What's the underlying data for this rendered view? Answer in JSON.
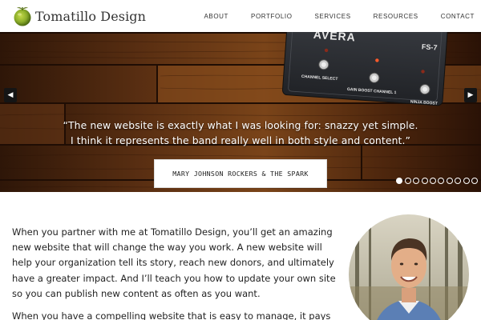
{
  "header": {
    "logo_text": "Tomatillo Design",
    "logo_icon": "tomatillo-icon",
    "nav": [
      {
        "label": "ABOUT"
      },
      {
        "label": "PORTFOLIO"
      },
      {
        "label": "SERVICES"
      },
      {
        "label": "RESOURCES"
      },
      {
        "label": "CONTACT"
      }
    ]
  },
  "hero": {
    "pedal_brand": "AVERA",
    "pedal_model": "FS-7",
    "knob_labels": [
      "CHANNEL SELECT",
      "GAIN BOOST CHANNEL 1",
      "NINJA BOOST"
    ],
    "quote_line1": "“The new website is exactly what I was looking for: snazzy yet simple.",
    "quote_line2": "I think it represents the band really well in both style and content.”",
    "attribution": "MARY JOHNSON ROCKERS & THE SPARK",
    "prev_icon": "chevron-left-icon",
    "next_icon": "chevron-right-icon",
    "slides_total": 10,
    "active_slide": 1
  },
  "intro": {
    "paragraph1": "When you partner with me at Tomatillo Design, you’ll get an amazing new website that will change the way you work. A new website will help your organization tell its story, reach new donors, and ultimately have a greater impact. And I’ll teach you how to update your own site so you can publish new content as often as you want.",
    "paragraph2": "When you have a compelling website that is easy to manage, it pays"
  },
  "colors": {
    "wood_dark": "#3a1d0c",
    "wood_mid": "#6b3a18",
    "pedal": "#2b2d31",
    "accent_green": "#8cae2a"
  }
}
